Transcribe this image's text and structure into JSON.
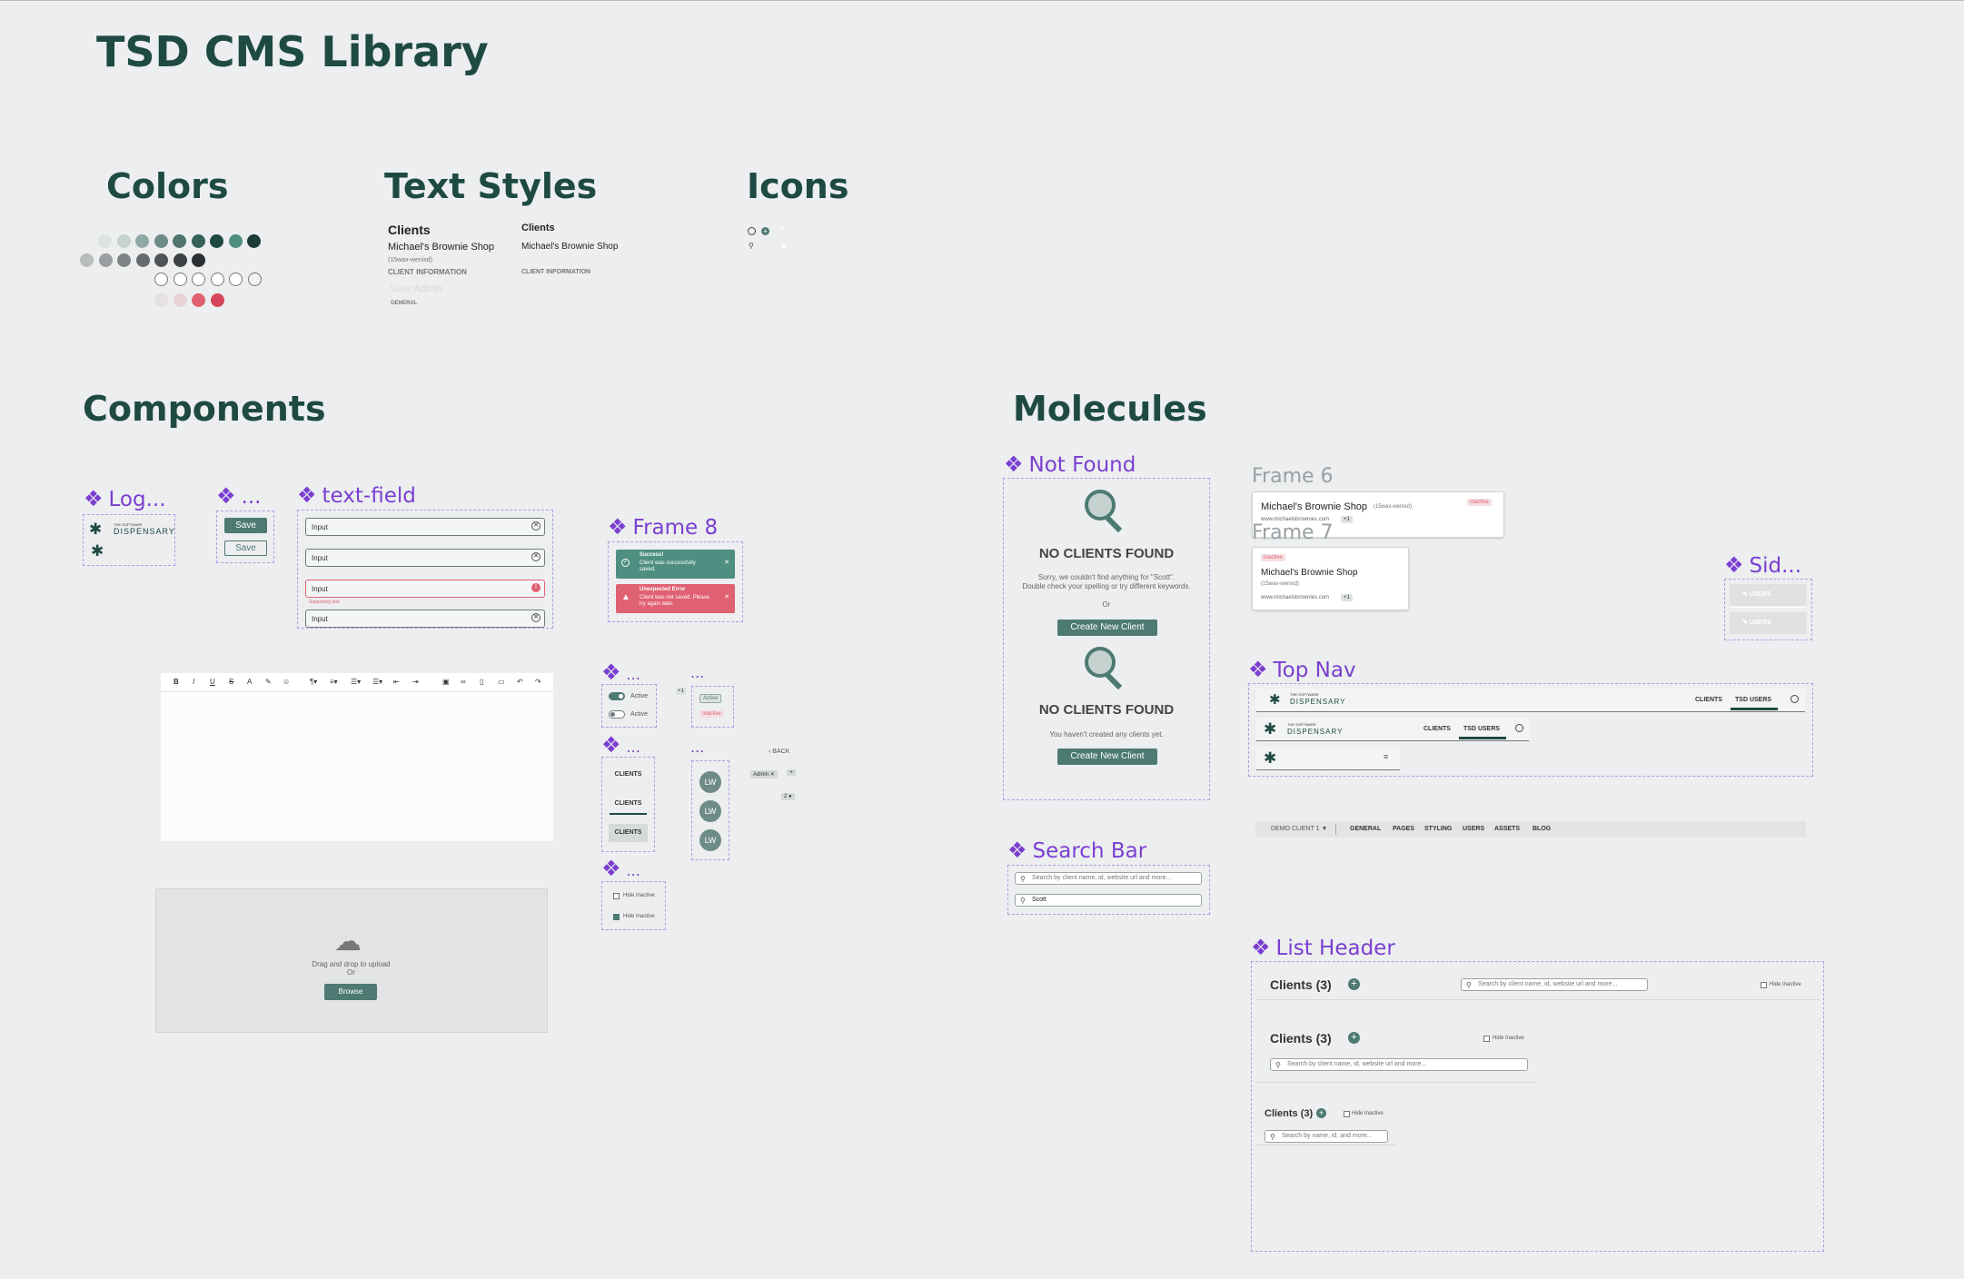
{
  "page": {
    "title": "TSD CMS Library"
  },
  "sections": {
    "colors": "Colors",
    "text_styles": "Text Styles",
    "icons": "Icons",
    "components": "Components",
    "molecules": "Molecules"
  },
  "palette": {
    "greens": [
      "#dde3e2",
      "#c5d2cf",
      "#8fa9a4",
      "#6d8c86",
      "#4f756e",
      "#36615a",
      "#1e4a43",
      "#4f8f81",
      "#1c3c37"
    ],
    "greys": [
      "#b8bcbd",
      "#9a9ea0",
      "#7f8385",
      "#676b6d",
      "#505456",
      "#3d4143",
      "#2c2f31"
    ],
    "outlines": [
      "#ffffff",
      "#ffffff",
      "#ffffff",
      "#ffffff",
      "#ffffff",
      "#f3f3f3"
    ],
    "reds": [
      "#e5e0e1",
      "#e7d3d6",
      "#e06171",
      "#d4465a"
    ]
  },
  "text_styles": {
    "col1": {
      "h1": "Clients",
      "h2": "Michael's Brownie Shop",
      "meta": "(15wax-wenixd)",
      "caps": "CLIENT INFORMATION",
      "light": "User Admin",
      "mini": "GENERAL"
    },
    "col2": {
      "h1": "Clients",
      "h2": "Michael's Brownie Shop",
      "caps": "CLIENT INFORMATION"
    }
  },
  "components": {
    "logo": {
      "label": "Log...",
      "brand_small": "THE SOFTWARE",
      "brand": "DISPENSARY"
    },
    "buttons": {
      "label": "...",
      "primary": "Save",
      "secondary": "Save"
    },
    "text_field": {
      "label": "text-field",
      "caption": "Label",
      "values": [
        "Input",
        "Input",
        "Input",
        "Input"
      ],
      "supporting": "Supporting text"
    },
    "frame8": {
      "label": "Frame 8",
      "success_title": "Success!",
      "success_text": "Client  was successfully saved.",
      "error_title": "Unexpected Error",
      "error_text": "Client  was not saved. Please try again later."
    },
    "toggles": {
      "label": "...",
      "items": [
        "Active",
        "Active"
      ]
    },
    "status": {
      "label": "...",
      "plus": "+1",
      "items": [
        "Active",
        "Inactive"
      ]
    },
    "tabs": {
      "label": "...",
      "items": [
        "CLIENTS",
        "CLIENTS",
        "CLIENTS"
      ]
    },
    "avatars": {
      "label": "...",
      "items": [
        "LW",
        "LW",
        "LW"
      ]
    },
    "checkboxes": {
      "label": "...",
      "items": [
        "Hide Inactive",
        "Hide Inactive"
      ]
    },
    "misc": {
      "back": "BACK",
      "chip": "Admin",
      "plus": "+",
      "count": "2"
    },
    "upload": {
      "text": "Drag and drop to upload",
      "or": "Or",
      "button": "Browse"
    }
  },
  "molecules": {
    "not_found": {
      "label": "Not Found",
      "title1": "NO CLIENTS FOUND",
      "text1a": "Sorry, we couldn't find anything for \"Scott\".",
      "text1b": "Double check your spelling or try different keywords.",
      "or": "Or",
      "button1": "Create New Client",
      "title2": "NO CLIENTS FOUND",
      "text2": "You haven't created any clients yet.",
      "button2": "Create New Client"
    },
    "frame6": {
      "label": "Frame 6",
      "name": "Michael's Brownie Shop",
      "meta": "(15wax-wenixd)",
      "status": "Inactive",
      "url": "www.michaelsbrownies.com",
      "plus": "+1"
    },
    "frame7": {
      "label": "Frame 7",
      "status": "Inactive",
      "name": "Michael's Brownie Shop",
      "meta": "(15wax-wenixd)",
      "url": "www.michaelsbrownies.com",
      "plus": "+1"
    },
    "sidebar": {
      "label": "Sid...",
      "items": [
        "USERS",
        "USERS"
      ]
    },
    "top_nav": {
      "label": "Top Nav",
      "brand_small": "THE SOFTWARE",
      "brand": "DISPENSARY",
      "nav1": [
        "CLIENTS",
        "TSD USERS"
      ],
      "nav2": [
        "CLIENTS",
        "TSD USERS"
      ]
    },
    "sub_nav": {
      "client": "DEMO CLIENT 1 ▼",
      "items": [
        "GENERAL",
        "PAGES",
        "STYLING",
        "USERS",
        "ASSETS",
        "BLOG"
      ]
    },
    "search_bar": {
      "label": "Search Bar",
      "placeholder": "Search by client name, id, website url and more...",
      "value": "Scott"
    },
    "list_header": {
      "label": "List Header",
      "title": "Clients (3)",
      "hide": "Hide Inactive",
      "placeholder": "Search by client name, id, website url and more...",
      "placeholder_short": "Search by name, id, and more..."
    }
  }
}
